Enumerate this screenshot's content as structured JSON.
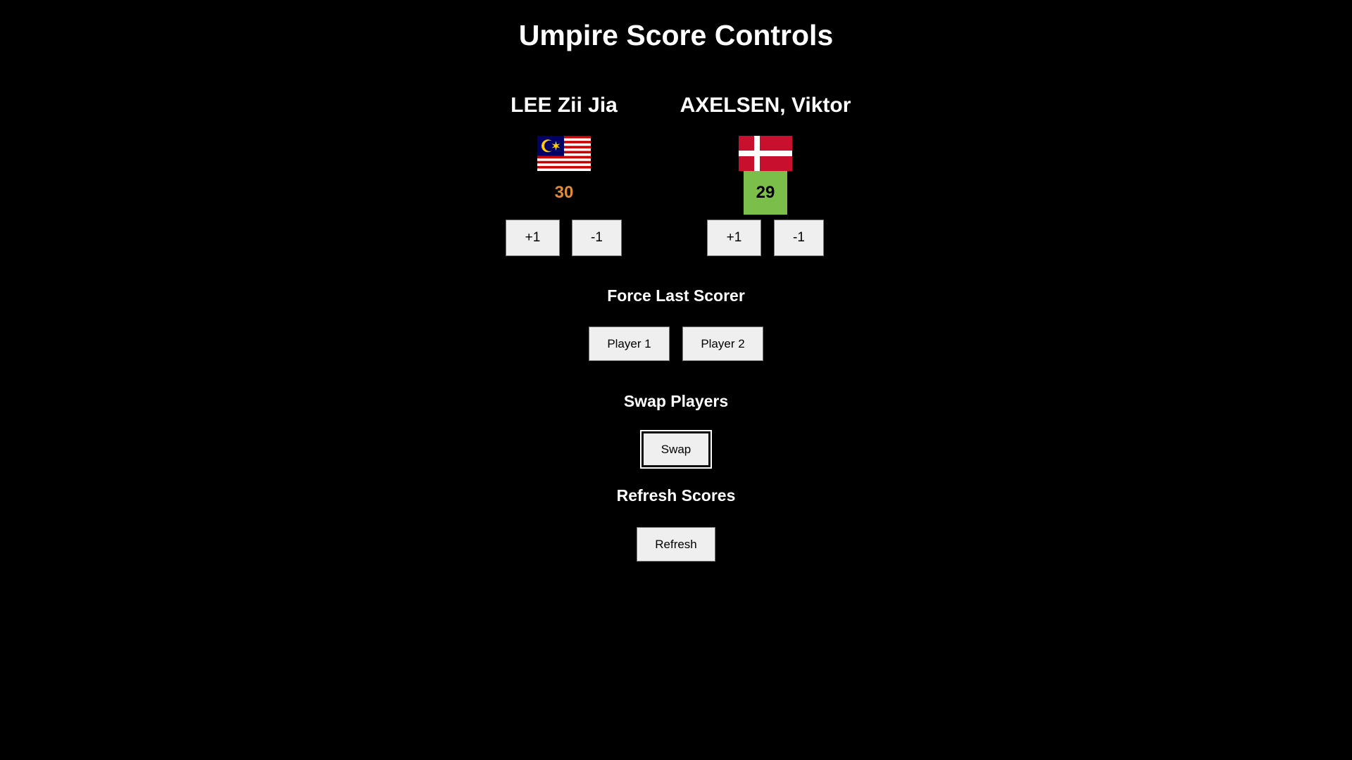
{
  "header": {
    "title": "Umpire Score Controls"
  },
  "players": [
    {
      "name": "LEE Zii Jia",
      "flag_icon": "malaysia-flag-icon",
      "score": "30",
      "score_color": "#e08a3c",
      "score_bg": "transparent",
      "plus_label": "+1",
      "minus_label": "-1"
    },
    {
      "name": "AXELSEN, Viktor",
      "flag_icon": "denmark-flag-icon",
      "score": "29",
      "score_color": "#000000",
      "score_bg": "#7bbf4a",
      "plus_label": "+1",
      "minus_label": "-1"
    }
  ],
  "force_last_scorer": {
    "heading": "Force Last Scorer",
    "player1_label": "Player 1",
    "player2_label": "Player 2"
  },
  "swap": {
    "heading": "Swap Players",
    "button_label": "Swap"
  },
  "refresh": {
    "heading": "Refresh Scores",
    "button_label": "Refresh"
  },
  "colors": {
    "background": "#000000",
    "text": "#ffffff",
    "button_bg": "#efefef",
    "malaysia_red": "#cc0001",
    "malaysia_blue": "#010066",
    "malaysia_yellow": "#ffcc00",
    "denmark_red": "#c8102e"
  }
}
